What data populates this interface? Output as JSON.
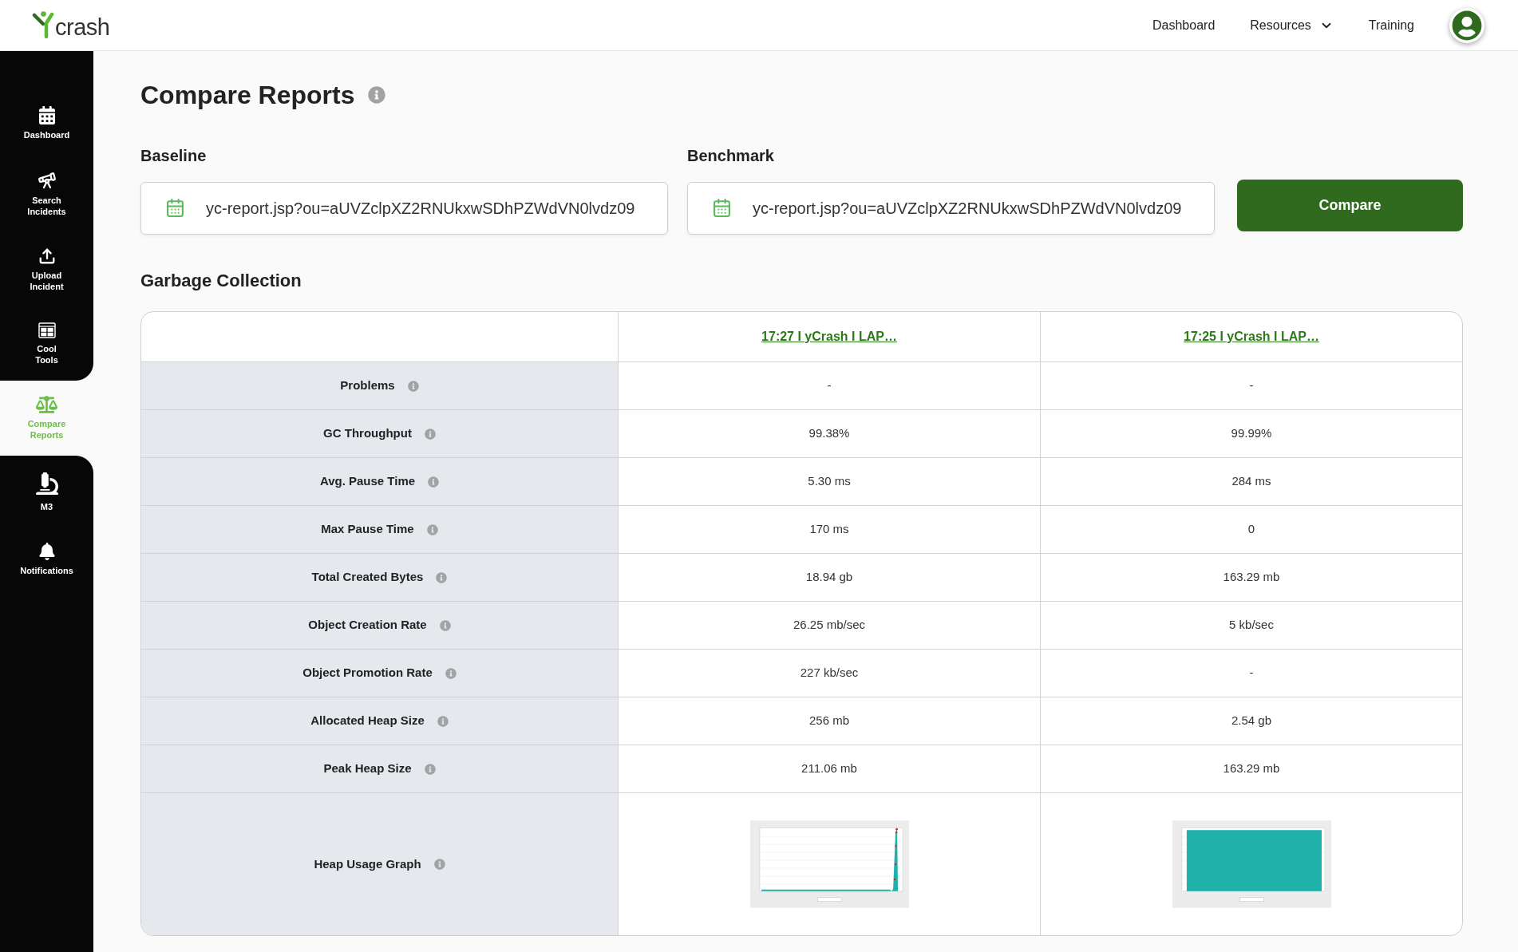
{
  "header": {
    "logo": {
      "text": "crash"
    },
    "nav": [
      {
        "label": "Dashboard",
        "kind": "link"
      },
      {
        "label": "Resources",
        "kind": "dropdown"
      },
      {
        "label": "Training",
        "kind": "link"
      }
    ]
  },
  "sidebar": {
    "items": [
      {
        "label": "Dashboard",
        "selected": false
      },
      {
        "label": "Search Incidents",
        "selected": false
      },
      {
        "label": "Upload Incident",
        "selected": false
      },
      {
        "label": "Cool Tools",
        "selected": false
      },
      {
        "label": "Compare Reports",
        "selected": true
      },
      {
        "label": "M3",
        "selected": false
      },
      {
        "label": "Notifications",
        "selected": false
      }
    ]
  },
  "page": {
    "title": "Compare Reports",
    "fields": [
      {
        "label": "Baseline",
        "value": "yc-report.jsp?ou=aUVZclpXZ2RNUkxwSDhPZWdVN0lvdz09"
      },
      {
        "label": "Benchmark",
        "value": "yc-report.jsp?ou=aUVZclpXZ2RNUkxwSDhPZWdVN0lvdz09"
      }
    ],
    "compare_button": "Compare"
  },
  "garbage_collection": {
    "heading": "Garbage Collection",
    "columns": [
      {
        "label": "17:27 I yCrash I LAP…"
      },
      {
        "label": "17:25 I yCrash I LAP…"
      }
    ],
    "rows": [
      {
        "kind": "text",
        "label": "Problems",
        "values": [
          "-",
          "-"
        ]
      },
      {
        "kind": "text",
        "label": "GC Throughput",
        "values": [
          "99.38%",
          "99.99%"
        ]
      },
      {
        "kind": "text",
        "label": "Avg. Pause Time",
        "values": [
          "5.30 ms",
          "284 ms"
        ]
      },
      {
        "kind": "text",
        "label": "Max Pause Time",
        "values": [
          "170 ms",
          "0"
        ]
      },
      {
        "kind": "text",
        "label": "Total Created Bytes",
        "values": [
          "18.94 gb",
          "163.29 mb"
        ]
      },
      {
        "kind": "text",
        "label": "Object Creation Rate",
        "values": [
          "26.25 mb/sec",
          "5 kb/sec"
        ]
      },
      {
        "kind": "text",
        "label": "Object Promotion Rate",
        "values": [
          "227 kb/sec",
          "-"
        ]
      },
      {
        "kind": "text",
        "label": "Allocated Heap Size",
        "values": [
          "256 mb",
          "2.54 gb"
        ]
      },
      {
        "kind": "text",
        "label": "Peak Heap Size",
        "values": [
          "211.06 mb",
          "163.29 mb"
        ]
      },
      {
        "kind": "graph",
        "label": "Heap Usage Graph"
      }
    ]
  }
}
